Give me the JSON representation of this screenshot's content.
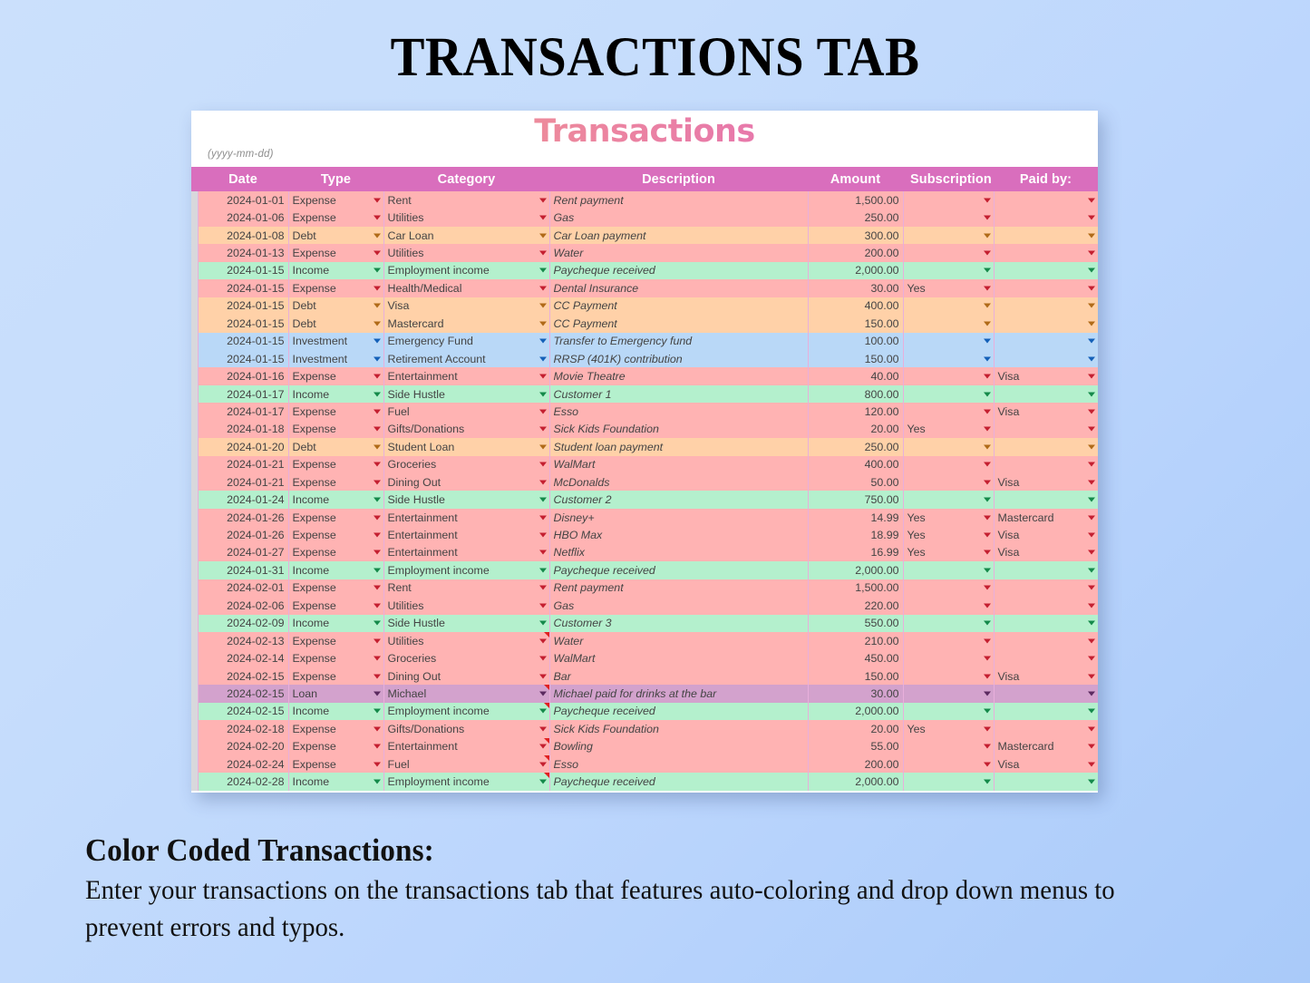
{
  "page": {
    "title": "TRANSACTIONS TAB",
    "background_top": "#cbe0fc",
    "background_bottom": "#a9caf9"
  },
  "sheet": {
    "title": "Transactions",
    "date_hint": "(yyyy-mm-dd)",
    "header_color": "#d96ebd",
    "title_gradient_from": "#f2a492",
    "title_gradient_to": "#df62b4",
    "columns": [
      "Date",
      "Type",
      "Category",
      "Description",
      "Amount",
      "Subscription",
      "Paid by:"
    ],
    "type_colors": {
      "Expense": "#ffb3b3",
      "Debt": "#ffd1a8",
      "Income": "#b4f0cd",
      "Investment": "#b9d8f7",
      "Loan": "#d3a2cd"
    },
    "rows": [
      {
        "date": "2024-01-01",
        "type": "Expense",
        "category": "Rent",
        "description": "Rent payment",
        "amount": "1,500.00",
        "subscription": "",
        "paid_by": "",
        "comment": false
      },
      {
        "date": "2024-01-06",
        "type": "Expense",
        "category": "Utilities",
        "description": "Gas",
        "amount": "250.00",
        "subscription": "",
        "paid_by": "",
        "comment": false
      },
      {
        "date": "2024-01-08",
        "type": "Debt",
        "category": "Car Loan",
        "description": "Car Loan payment",
        "amount": "300.00",
        "subscription": "",
        "paid_by": "",
        "comment": false
      },
      {
        "date": "2024-01-13",
        "type": "Expense",
        "category": "Utilities",
        "description": "Water",
        "amount": "200.00",
        "subscription": "",
        "paid_by": "",
        "comment": false
      },
      {
        "date": "2024-01-15",
        "type": "Income",
        "category": "Employment income",
        "description": "Paycheque received",
        "amount": "2,000.00",
        "subscription": "",
        "paid_by": "",
        "comment": false
      },
      {
        "date": "2024-01-15",
        "type": "Expense",
        "category": "Health/Medical",
        "description": "Dental Insurance",
        "amount": "30.00",
        "subscription": "Yes",
        "paid_by": "",
        "comment": false
      },
      {
        "date": "2024-01-15",
        "type": "Debt",
        "category": "Visa",
        "description": "CC Payment",
        "amount": "400.00",
        "subscription": "",
        "paid_by": "",
        "comment": false
      },
      {
        "date": "2024-01-15",
        "type": "Debt",
        "category": "Mastercard",
        "description": "CC Payment",
        "amount": "150.00",
        "subscription": "",
        "paid_by": "",
        "comment": false
      },
      {
        "date": "2024-01-15",
        "type": "Investment",
        "category": "Emergency Fund",
        "description": "Transfer to Emergency fund",
        "amount": "100.00",
        "subscription": "",
        "paid_by": "",
        "comment": false
      },
      {
        "date": "2024-01-15",
        "type": "Investment",
        "category": "Retirement Account",
        "description": "RRSP (401K) contribution",
        "amount": "150.00",
        "subscription": "",
        "paid_by": "",
        "comment": false
      },
      {
        "date": "2024-01-16",
        "type": "Expense",
        "category": "Entertainment",
        "description": "Movie Theatre",
        "amount": "40.00",
        "subscription": "",
        "paid_by": "Visa",
        "comment": false
      },
      {
        "date": "2024-01-17",
        "type": "Income",
        "category": "Side Hustle",
        "description": "Customer 1",
        "amount": "800.00",
        "subscription": "",
        "paid_by": "",
        "comment": false
      },
      {
        "date": "2024-01-17",
        "type": "Expense",
        "category": "Fuel",
        "description": "Esso",
        "amount": "120.00",
        "subscription": "",
        "paid_by": "Visa",
        "comment": false
      },
      {
        "date": "2024-01-18",
        "type": "Expense",
        "category": "Gifts/Donations",
        "description": "Sick Kids Foundation",
        "amount": "20.00",
        "subscription": "Yes",
        "paid_by": "",
        "comment": false
      },
      {
        "date": "2024-01-20",
        "type": "Debt",
        "category": "Student Loan",
        "description": "Student loan payment",
        "amount": "250.00",
        "subscription": "",
        "paid_by": "",
        "comment": false
      },
      {
        "date": "2024-01-21",
        "type": "Expense",
        "category": "Groceries",
        "description": "WalMart",
        "amount": "400.00",
        "subscription": "",
        "paid_by": "",
        "comment": false
      },
      {
        "date": "2024-01-21",
        "type": "Expense",
        "category": "Dining Out",
        "description": "McDonalds",
        "amount": "50.00",
        "subscription": "",
        "paid_by": "Visa",
        "comment": false
      },
      {
        "date": "2024-01-24",
        "type": "Income",
        "category": "Side Hustle",
        "description": "Customer 2",
        "amount": "750.00",
        "subscription": "",
        "paid_by": "",
        "comment": false
      },
      {
        "date": "2024-01-26",
        "type": "Expense",
        "category": "Entertainment",
        "description": "Disney+",
        "amount": "14.99",
        "subscription": "Yes",
        "paid_by": "Mastercard",
        "comment": false
      },
      {
        "date": "2024-01-26",
        "type": "Expense",
        "category": "Entertainment",
        "description": "HBO Max",
        "amount": "18.99",
        "subscription": "Yes",
        "paid_by": "Visa",
        "comment": false
      },
      {
        "date": "2024-01-27",
        "type": "Expense",
        "category": "Entertainment",
        "description": "Netflix",
        "amount": "16.99",
        "subscription": "Yes",
        "paid_by": "Visa",
        "comment": false
      },
      {
        "date": "2024-01-31",
        "type": "Income",
        "category": "Employment income",
        "description": "Paycheque received",
        "amount": "2,000.00",
        "subscription": "",
        "paid_by": "",
        "comment": false
      },
      {
        "date": "2024-02-01",
        "type": "Expense",
        "category": "Rent",
        "description": "Rent payment",
        "amount": "1,500.00",
        "subscription": "",
        "paid_by": "",
        "comment": false
      },
      {
        "date": "2024-02-06",
        "type": "Expense",
        "category": "Utilities",
        "description": "Gas",
        "amount": "220.00",
        "subscription": "",
        "paid_by": "",
        "comment": false
      },
      {
        "date": "2024-02-09",
        "type": "Income",
        "category": "Side Hustle",
        "description": "Customer 3",
        "amount": "550.00",
        "subscription": "",
        "paid_by": "",
        "comment": false
      },
      {
        "date": "2024-02-13",
        "type": "Expense",
        "category": "Utilities",
        "description": "Water",
        "amount": "210.00",
        "subscription": "",
        "paid_by": "",
        "comment": true
      },
      {
        "date": "2024-02-14",
        "type": "Expense",
        "category": "Groceries",
        "description": "WalMart",
        "amount": "450.00",
        "subscription": "",
        "paid_by": "",
        "comment": false
      },
      {
        "date": "2024-02-15",
        "type": "Expense",
        "category": "Dining Out",
        "description": "Bar",
        "amount": "150.00",
        "subscription": "",
        "paid_by": "Visa",
        "comment": false
      },
      {
        "date": "2024-02-15",
        "type": "Loan",
        "category": "Michael",
        "description": "Michael paid for drinks at the bar",
        "amount": "30.00",
        "subscription": "",
        "paid_by": "",
        "comment": true
      },
      {
        "date": "2024-02-15",
        "type": "Income",
        "category": "Employment income",
        "description": "Paycheque received",
        "amount": "2,000.00",
        "subscription": "",
        "paid_by": "",
        "comment": true
      },
      {
        "date": "2024-02-18",
        "type": "Expense",
        "category": "Gifts/Donations",
        "description": "Sick Kids Foundation",
        "amount": "20.00",
        "subscription": "Yes",
        "paid_by": "",
        "comment": false
      },
      {
        "date": "2024-02-20",
        "type": "Expense",
        "category": "Entertainment",
        "description": "Bowling",
        "amount": "55.00",
        "subscription": "",
        "paid_by": "Mastercard",
        "comment": true
      },
      {
        "date": "2024-02-24",
        "type": "Expense",
        "category": "Fuel",
        "description": "Esso",
        "amount": "200.00",
        "subscription": "",
        "paid_by": "Visa",
        "comment": true
      },
      {
        "date": "2024-02-28",
        "type": "Income",
        "category": "Employment income",
        "description": "Paycheque received",
        "amount": "2,000.00",
        "subscription": "",
        "paid_by": "",
        "comment": true
      }
    ]
  },
  "caption": {
    "heading": "Color Coded Transactions:",
    "body": "Enter your transactions on the transactions tab that features auto-coloring and drop down menus to prevent errors and typos."
  }
}
